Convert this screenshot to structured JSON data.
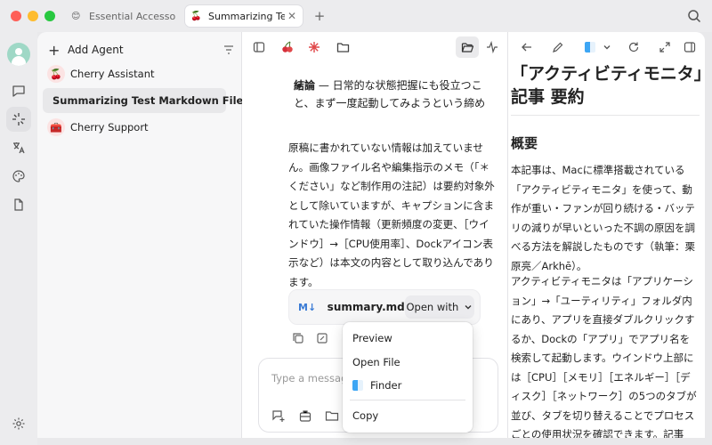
{
  "titlebar": {
    "tabs": [
      {
        "label": "Essential Accessories",
        "icon": "emoji-icon"
      },
      {
        "label": "Summarizing Test",
        "icon": "cherry-icon"
      }
    ]
  },
  "agents_panel": {
    "add_label": "Add Agent",
    "items": [
      {
        "label": "Cherry Assistant",
        "icon": "🍒"
      },
      {
        "label": "Summarizing Test Markdown File",
        "icon": ""
      },
      {
        "label": "Cherry Support",
        "icon": "🧰"
      }
    ]
  },
  "chat": {
    "bullet_bold": "結論",
    "bullet_text": " — 日常的な状態把握にも役立つこと、まず一度起動してみようという締め",
    "paragraph": "原稿に書かれていない情報は加えていません。画像ファイル名や編集指示のメモ（「＊ください」など制作用の注記）は要約対象外として除いていますが、キャプションに含まれていた操作情報（更新頻度の変更、［ウインドウ］→［CPU使用率］、Dockアイコン表示など）は本文の内容として取り込んであります。",
    "file": {
      "icon_text": "M↓",
      "name": "summary.md",
      "open_with_label": "Open with"
    },
    "input_placeholder": "Type a message"
  },
  "context_menu": {
    "items": [
      "Preview",
      "Open File",
      "Finder",
      "Copy"
    ]
  },
  "document": {
    "title": "「アクティビティモニタ」記事 要約",
    "heading": "概要",
    "p1": "本記事は、Macに標準搭載されている「アクティビティモニタ」を使って、動作が重い・ファンが回り続ける・バッテリの減りが早いといった不調の原因を調べる方法を解説したものです（執筆：栗原亮／Arkhē）。",
    "p2": "アクティビティモニタは「アプリケーション」→「ユーティリティ」フォルダ内にあり、アプリを直接ダブルクリックするか、Dockの「アプリ」でアプリ名を検索して起動します。ウインドウ上部には［CPU］［メモリ］［エネルギー］［ディスク］［ネットワーク］の5つのタブが並び、タブを切り替えることでプロセスごとの使用状況を確認できます。記事は、基本的な見方から負荷状況の"
  },
  "colors": {
    "accent_red": "#e0484a",
    "avatar_green": "#9fd8c6",
    "md_blue": "#3a7bd5"
  }
}
